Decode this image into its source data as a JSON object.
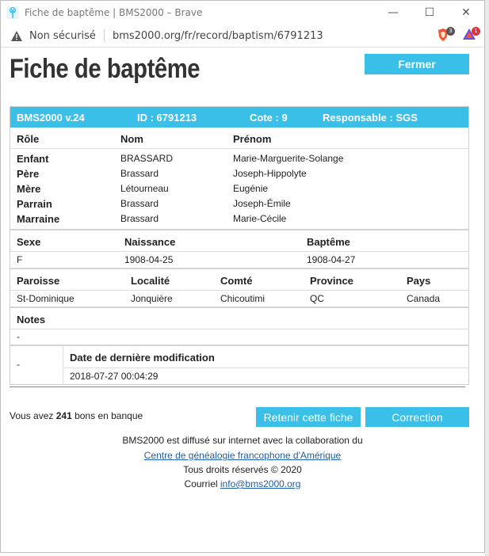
{
  "window": {
    "title": "Fiche de baptême | BMS2000 – Brave",
    "controls": {
      "minimize": "—",
      "maximize": "☐",
      "close": "✕"
    }
  },
  "addressbar": {
    "security_label": "Non sécurisé",
    "url": "bms2000.org/fr/record/baptism/6791213",
    "extensions": [
      {
        "name": "brave-shields-icon",
        "badge": "3",
        "color": "#fb542b"
      },
      {
        "name": "brave-rewards-icon",
        "badge": "1",
        "color": "#6b4fd8"
      }
    ]
  },
  "page": {
    "title": "Fiche de baptême",
    "close_button": "Fermer"
  },
  "record": {
    "version": "BMS2000 v.24",
    "id": "ID : 6791213",
    "cote": "Cote : 9",
    "responsable": "Responsable : SGS",
    "persons_headers": {
      "role": "Rôle",
      "nom": "Nom",
      "prenom": "Prénom"
    },
    "persons": [
      {
        "role": "Enfant",
        "nom": "BRASSARD",
        "prenom": "Marie-Marguerite-Solange"
      },
      {
        "role": "Père",
        "nom": "Brassard",
        "prenom": "Joseph-Hippolyte"
      },
      {
        "role": "Mère",
        "nom": "Létourneau",
        "prenom": "Eugénie"
      },
      {
        "role": "Parrain",
        "nom": "Brassard",
        "prenom": "Joseph-Émile"
      },
      {
        "role": "Marraine",
        "nom": "Brassard",
        "prenom": "Marie-Cécile"
      }
    ],
    "vital_headers": {
      "sexe": "Sexe",
      "naissance": "Naissance",
      "bapteme": "Baptême"
    },
    "vital": {
      "sexe": "F",
      "naissance": "1908-04-25",
      "bapteme": "1908-04-27"
    },
    "place_headers": {
      "paroisse": "Paroisse",
      "localite": "Localité",
      "comte": "Comté",
      "province": "Province",
      "pays": "Pays"
    },
    "place": {
      "paroisse": "St-Dominique",
      "localite": "Jonquière",
      "comte": "Chicoutimi",
      "province": "QC",
      "pays": "Canada"
    },
    "notes_label": "Notes",
    "notes_value": "-",
    "modification": {
      "left_value": "-",
      "label": "Date de dernière modification",
      "value": "2018-07-27 00:04:29"
    }
  },
  "bank": {
    "prefix": "Vous avez ",
    "count": "241",
    "suffix": " bons en banque"
  },
  "actions": {
    "retenir": "Retenir cette fiche",
    "correction": "Correction"
  },
  "footer": {
    "line1": "BMS2000 est diffusé sur internet avec la collaboration du",
    "link": "Centre de généalogie francophone d'Amérique",
    "rights": "Tous droits réservés © 2020",
    "email_prefix": "Courriel ",
    "email": "info@bms2000.org"
  },
  "colors": {
    "accent": "#39bfe8",
    "link": "#1e5fa8"
  }
}
